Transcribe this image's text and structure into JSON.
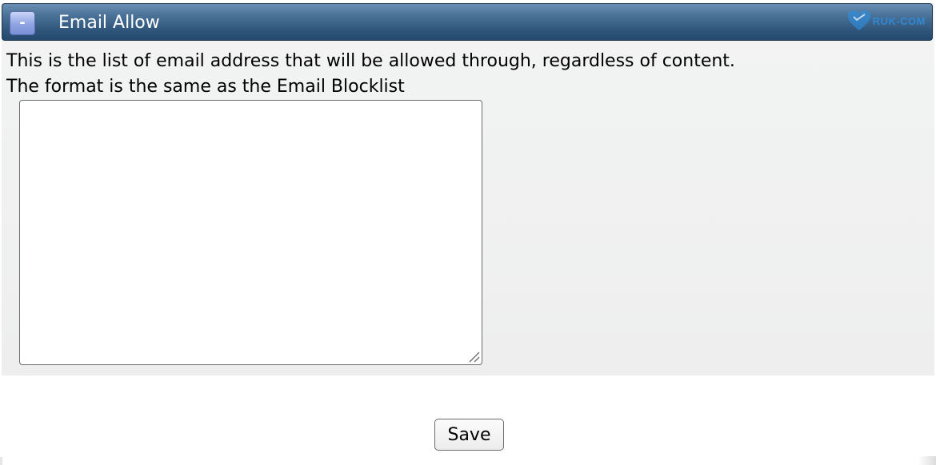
{
  "panel": {
    "collapse_label": "-",
    "title": "Email Allow",
    "brand_text": "RUK-COM",
    "description_line1": "This is the list of email address that will be allowed through, regardless of content.",
    "description_line2": "The format is the same as the Email Blocklist",
    "allow_list_value": ""
  },
  "footer": {
    "save_label": "Save"
  },
  "colors": {
    "header_top": "#6a8fb4",
    "header_bottom": "#24486d",
    "collapse_button": "#8fa3e3",
    "panel_background": "#f2f4f3",
    "brand": "#2f8fe0"
  },
  "icons": {
    "brand_logo": "heart-logo-icon",
    "resize_grip": "resize-grip-icon"
  }
}
